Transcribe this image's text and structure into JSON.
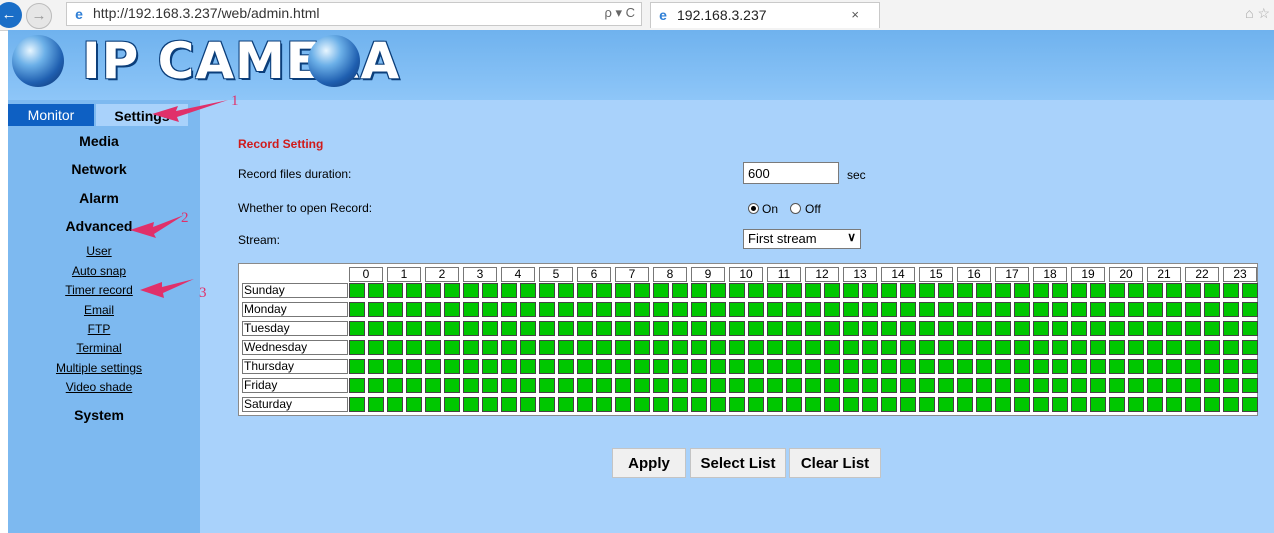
{
  "browser": {
    "back_icon": "back-arrow-icon",
    "forward_icon": "forward-arrow-icon",
    "address": "http://192.168.3.237/web/admin.html",
    "address_controls": "ρ ▾ C",
    "tab_title": "192.168.3.237",
    "tab_close": "×",
    "toolbar_right": "⌂ ☆"
  },
  "header": {
    "logo_text": "IP CAMERA"
  },
  "sidebar": {
    "tabs": [
      {
        "label": "Monitor",
        "active": false
      },
      {
        "label": "Settings",
        "active": true
      }
    ],
    "menu": [
      {
        "label": "Media"
      },
      {
        "label": "Network"
      },
      {
        "label": "Alarm"
      },
      {
        "label": "Advanced"
      }
    ],
    "advanced_items": [
      {
        "label": "User"
      },
      {
        "label": "Auto snap"
      },
      {
        "label": "Timer record"
      },
      {
        "label": "Email"
      },
      {
        "label": "FTP"
      },
      {
        "label": "Terminal"
      },
      {
        "label": "Multiple settings"
      },
      {
        "label": "Video shade"
      }
    ],
    "system_label": "System"
  },
  "annotations": [
    "1",
    "2",
    "3"
  ],
  "record": {
    "title": "Record Setting",
    "duration_label": "Record files duration:",
    "duration_value": "600",
    "duration_unit": "sec",
    "open_record_label": "Whether to open Record:",
    "option_on": "On",
    "option_off": "Off",
    "selected_option": "On",
    "stream_label": "Stream:",
    "stream_value": "First stream"
  },
  "schedule": {
    "days": [
      "Sunday",
      "Monday",
      "Tuesday",
      "Wednesday",
      "Thursday",
      "Friday",
      "Saturday"
    ],
    "hours": [
      "0",
      "1",
      "2",
      "3",
      "4",
      "5",
      "6",
      "7",
      "8",
      "9",
      "10",
      "11",
      "12",
      "13",
      "14",
      "15",
      "16",
      "17",
      "18",
      "19",
      "20",
      "21",
      "22",
      "23"
    ],
    "cells_per_hour": 2,
    "all_selected": true,
    "selected_color": "#00c700"
  },
  "buttons": {
    "apply": "Apply",
    "select_list": "Select List",
    "clear_list": "Clear List"
  },
  "colors": {
    "header_blue": "#7fbcf3",
    "sidebar_blue": "#7db9f0",
    "main_blue": "#a9d2fb",
    "annotation_pink": "#e0306a",
    "title_red": "#d01a1a"
  }
}
